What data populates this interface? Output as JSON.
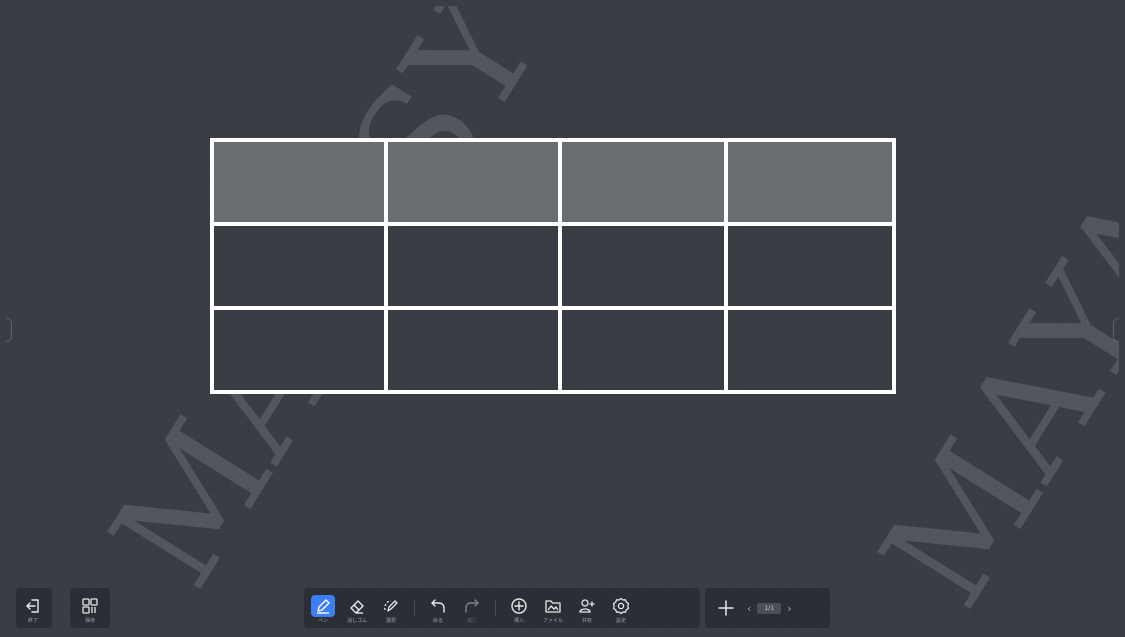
{
  "watermark": "MAYASY",
  "table": {
    "rows": 3,
    "cols": 4,
    "header_color": "#6a6d70",
    "border_color": "#ffffff"
  },
  "left_toolbar": {
    "exit_label": "終了",
    "menu_label": "保存"
  },
  "main_toolbar": {
    "pen_label": "ペン",
    "eraser_label": "消しゴム",
    "select_label": "選択",
    "undo_label": "戻る",
    "redo_label": "進む",
    "insert_label": "挿入",
    "file_label": "ファイル",
    "share_label": "共有",
    "settings_label": "設定"
  },
  "page_nav": {
    "page_indicator": "1/1"
  },
  "colors": {
    "canvas": "#3a3d44",
    "toolbar_bg": "#2b2e34",
    "active_tool": "#3d7ef5"
  }
}
